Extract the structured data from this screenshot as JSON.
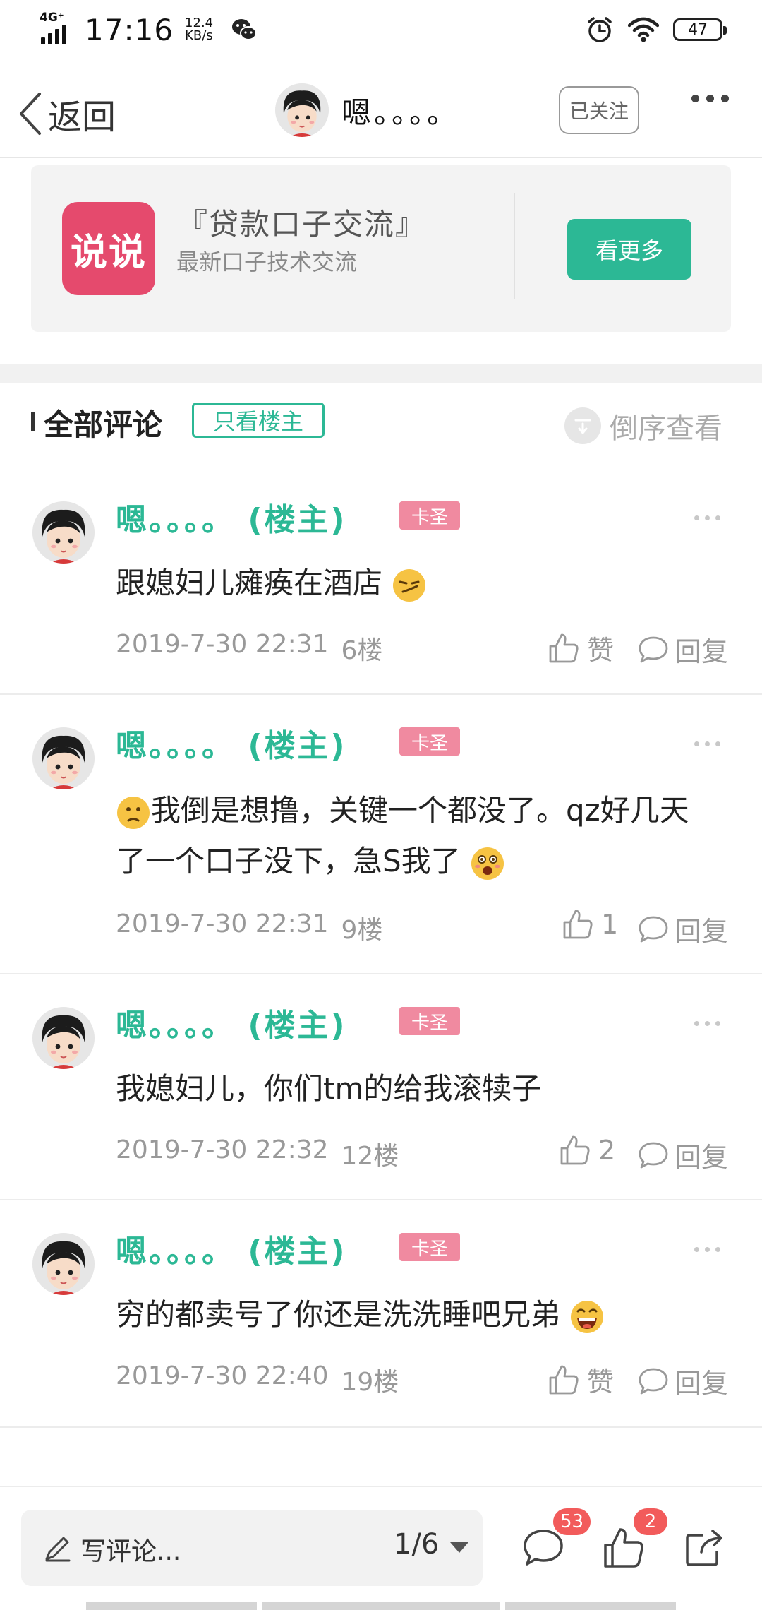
{
  "status_bar": {
    "network": "4G⁺",
    "time": "17:16",
    "speed_value": "12.4",
    "speed_unit": "KB/s",
    "battery": "47",
    "icons": [
      "signal-icon",
      "wechat-icon",
      "alarm-icon",
      "wifi-icon",
      "battery-icon"
    ]
  },
  "nav": {
    "back_label": "返回",
    "title": "嗯。。。。",
    "follow_label": "已关注"
  },
  "promo": {
    "logo_text": "说说",
    "title": "『贷款口子交流』",
    "subtitle": "最新口子技术交流",
    "button_label": "看更多"
  },
  "comments_header": {
    "title": "全部评论",
    "only_op_label": "只看楼主",
    "sort_label": "倒序查看"
  },
  "comments": [
    {
      "name": "嗯。。。。",
      "op_tag": "(楼主)",
      "badge": "卡圣",
      "text": "跟媳妇儿瘫痪在酒店",
      "date": "2019-7-30 22:31",
      "floor": "6楼",
      "like_label": "赞",
      "reply_label": "回复"
    },
    {
      "name": "嗯。。。。",
      "op_tag": "(楼主)",
      "badge": "卡圣",
      "text": "我倒是想撸，关键一个都没了。qz好几天了一个口子没下，急S我了",
      "date": "2019-7-30 22:31",
      "floor": "9楼",
      "like_label": "1",
      "reply_label": "回复"
    },
    {
      "name": "嗯。。。。",
      "op_tag": "(楼主)",
      "badge": "卡圣",
      "text": "我媳妇儿，你们tm的给我滚犊子",
      "date": "2019-7-30 22:32",
      "floor": "12楼",
      "like_label": "2",
      "reply_label": "回复"
    },
    {
      "name": "嗯。。。。",
      "op_tag": "(楼主)",
      "badge": "卡圣",
      "text": "穷的都卖号了你还是洗洗睡吧兄弟",
      "date": "2019-7-30 22:40",
      "floor": "19楼",
      "like_label": "赞",
      "reply_label": "回复"
    }
  ],
  "bottom_bar": {
    "placeholder": "写评论...",
    "page_indicator": "1/6",
    "comment_count": "53",
    "like_count": "2"
  },
  "colors": {
    "accent": "#2cb895",
    "badge_pink": "#f08aa0",
    "logo_red": "#e54a6d",
    "notify_red": "#f25b5b"
  }
}
